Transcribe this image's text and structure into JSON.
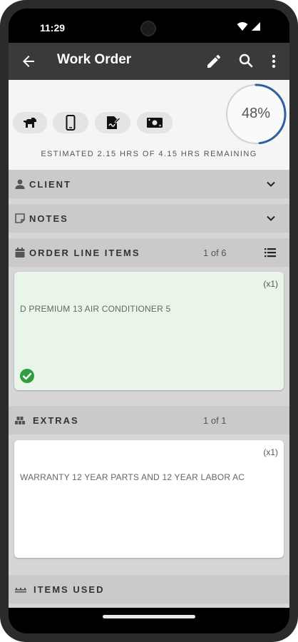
{
  "status_bar": {
    "time": "11:29"
  },
  "app_bar": {
    "title": "Work Order",
    "icons": [
      "back-arrow-icon",
      "edit-pencil-icon",
      "search-icon",
      "more-vert-icon"
    ]
  },
  "summary": {
    "quick_actions": [
      "dog-icon",
      "phone-icon",
      "signature-icon",
      "cash-icon"
    ],
    "progress_percent": 48,
    "progress_label": "48%",
    "estimate_text": "ESTIMATED 2.15 HRS OF 4.15 HRS REMAINING"
  },
  "sections": {
    "client": {
      "label": "CLIENT"
    },
    "notes": {
      "label": "NOTES"
    },
    "order_line_items": {
      "label": "ORDER LINE ITEMS",
      "count": "1 of 6",
      "item": {
        "qty": "(x1)",
        "description": "D PREMIUM 13 AIR CONDITIONER 5",
        "completed": true
      }
    },
    "extras": {
      "label": "EXTRAS",
      "count": "1 of 1",
      "item": {
        "qty": "(x1)",
        "description": "WARRANTY 12 YEAR PARTS AND 12 YEAR LABOR AC"
      }
    },
    "items_used": {
      "label": "ITEMS USED"
    }
  },
  "colors": {
    "app_bar": "#3a3a3a",
    "progress_arc": "#2f5f9e",
    "completed_card": "#e9f5e9",
    "check_green": "#2e9e3f"
  }
}
